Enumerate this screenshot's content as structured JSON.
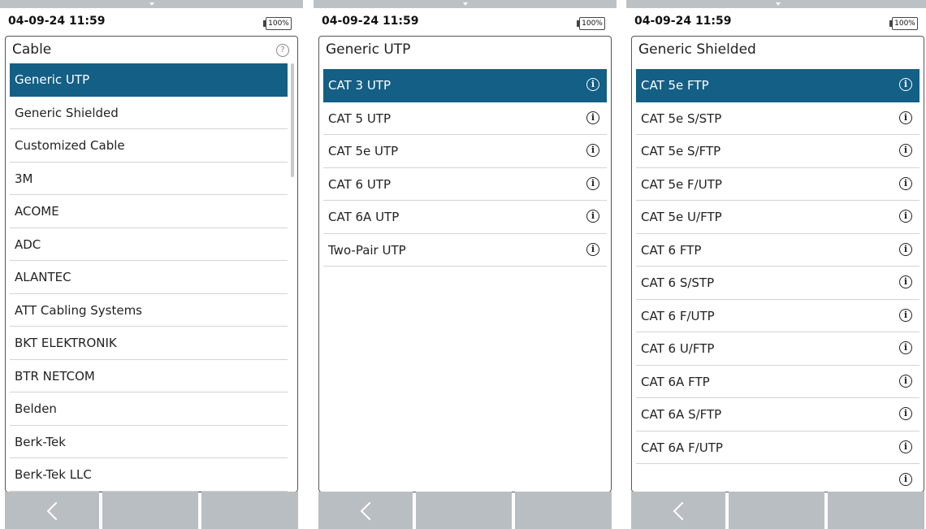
{
  "panels": [
    {
      "datetime": "04-09-24 11:59",
      "battery": "100%",
      "title": "Cable",
      "help_icon": "question-circle-icon",
      "items": [
        {
          "label": "Generic UTP",
          "selected": true
        },
        {
          "label": "Generic Shielded"
        },
        {
          "label": "Customized Cable"
        },
        {
          "label": "3M"
        },
        {
          "label": "ACOME"
        },
        {
          "label": "ADC"
        },
        {
          "label": "ALANTEC"
        },
        {
          "label": "ATT Cabling Systems"
        },
        {
          "label": "BKT ELEKTRONIK"
        },
        {
          "label": "BTR NETCOM"
        },
        {
          "label": "Belden"
        },
        {
          "label": "Berk-Tek"
        },
        {
          "label": "Berk-Tek LLC"
        }
      ]
    },
    {
      "datetime": "04-09-24 11:59",
      "battery": "100%",
      "title": "Generic UTP",
      "items": [
        {
          "label": "CAT 3 UTP",
          "selected": true
        },
        {
          "label": "CAT 5 UTP"
        },
        {
          "label": "CAT 5e UTP"
        },
        {
          "label": "CAT 6 UTP"
        },
        {
          "label": "CAT 6A UTP"
        },
        {
          "label": "Two-Pair UTP"
        }
      ]
    },
    {
      "datetime": "04-09-24 11:59",
      "battery": "100%",
      "title": "Generic Shielded",
      "items": [
        {
          "label": "CAT 5e FTP",
          "selected": true
        },
        {
          "label": "CAT 5e S/STP"
        },
        {
          "label": "CAT 5e S/FTP"
        },
        {
          "label": "CAT 5e F/UTP"
        },
        {
          "label": "CAT 5e U/FTP"
        },
        {
          "label": "CAT 6 FTP"
        },
        {
          "label": "CAT 6 S/STP"
        },
        {
          "label": "CAT 6 F/UTP"
        },
        {
          "label": "CAT 6 U/FTP"
        },
        {
          "label": "CAT 6A FTP"
        },
        {
          "label": "CAT 6A S/FTP"
        },
        {
          "label": "CAT 6A F/UTP"
        },
        {
          "label": "",
          "faded": true
        }
      ]
    }
  ],
  "icons": {
    "info": "info-circle-icon",
    "back": "back-arrow-icon"
  },
  "colors": {
    "selected_bg": "#135f85",
    "button_bg": "#b9bec3",
    "topbar_bg": "#bcc1c6"
  }
}
